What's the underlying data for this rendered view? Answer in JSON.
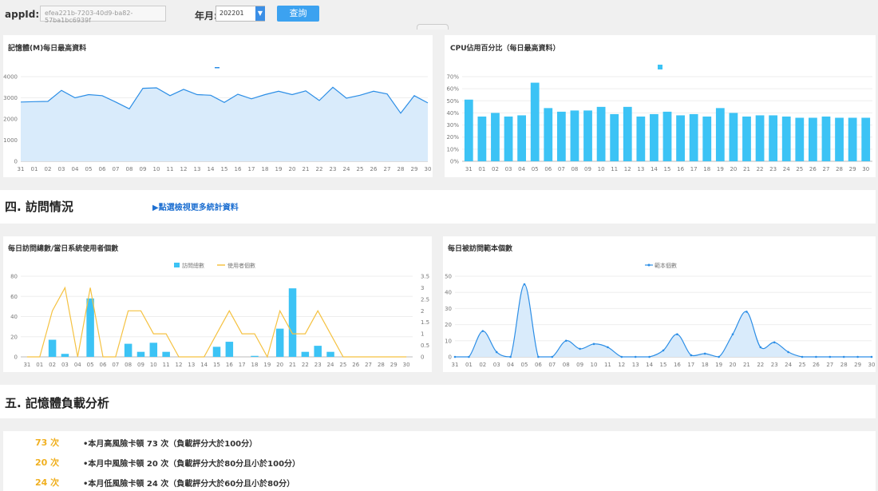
{
  "toolbar": {
    "appid_label": "appId:",
    "appid_value": "efea221b-7203-40d9-ba82-57ba1bc6939f",
    "month_label": "年月:",
    "month_value": "202201",
    "query_label": "查詢"
  },
  "days": [
    "31",
    "01",
    "02",
    "03",
    "04",
    "05",
    "06",
    "07",
    "08",
    "09",
    "10",
    "11",
    "12",
    "13",
    "14",
    "15",
    "16",
    "17",
    "18",
    "19",
    "20",
    "21",
    "22",
    "23",
    "24",
    "25",
    "26",
    "27",
    "28",
    "29",
    "30"
  ],
  "colors": {
    "accent": "#3ca2f0",
    "bar": "#3cc3f5",
    "line": "#f5c242",
    "area": "#d9ebfb",
    "stroke": "#2c8ee6"
  },
  "sections": {
    "visits_title": "四. 訪問情況",
    "visits_link": "▶點選檢視更多統計資料",
    "memory_title": "五. 記憶體負載分析"
  },
  "stats": [
    {
      "count": "73 次",
      "text": "•本月高風險卡頓 73 次（負載評分大於100分）"
    },
    {
      "count": "20 次",
      "text": "•本月中風險卡頓 20 次（負載評分大於80分且小於100分）"
    },
    {
      "count": "24 次",
      "text": "•本月低風險卡頓 24 次（負載評分大於60分且小於80分）"
    }
  ],
  "chart_data": [
    {
      "type": "area",
      "title": "記憶體(M)每日最高資料",
      "legend": "",
      "ylim": [
        0,
        4000
      ],
      "yticks": [
        "0",
        "1000",
        "2000",
        "3000",
        "4000"
      ],
      "values": [
        2800,
        2820,
        2830,
        3350,
        3000,
        3150,
        3100,
        2800,
        2480,
        3450,
        3470,
        3100,
        3400,
        3150,
        3120,
        2780,
        3170,
        2950,
        3150,
        3310,
        3150,
        3330,
        2870,
        3500,
        2980,
        3120,
        3310,
        3180,
        2270,
        3100,
        2760
      ]
    },
    {
      "type": "bar",
      "title": "CPU佔用百分比（每日最高資料）",
      "ylim": [
        0,
        70
      ],
      "yticks": [
        "0%",
        "10%",
        "20%",
        "30%",
        "40%",
        "50%",
        "60%",
        "70%"
      ],
      "values": [
        51,
        37,
        40,
        37,
        38,
        65,
        44,
        41,
        42,
        42,
        45,
        39,
        45,
        37,
        39,
        41,
        38,
        39,
        37,
        44,
        40,
        37,
        38,
        38,
        37,
        36,
        36,
        37,
        36,
        36,
        36
      ]
    },
    {
      "type": "bar+line",
      "title": "每日訪問總數/當日系統使用者個數",
      "series": [
        {
          "name": "訪問總數",
          "type": "bar",
          "values": [
            0,
            0,
            17,
            3,
            0,
            58,
            0,
            0,
            13,
            5,
            14,
            5,
            0,
            0,
            0,
            10,
            15,
            0,
            1,
            0,
            28,
            68,
            5,
            11,
            5,
            0,
            0,
            0,
            0,
            0,
            0
          ]
        },
        {
          "name": "使用者個數",
          "type": "line",
          "values": [
            0,
            0,
            2,
            3,
            0,
            3,
            0,
            0,
            2,
            2,
            1,
            1,
            0,
            0,
            0,
            1,
            2,
            1,
            1,
            0,
            2,
            1,
            1,
            2,
            1,
            0,
            0,
            0,
            0,
            0,
            0
          ]
        }
      ],
      "ylim_left": [
        0,
        80
      ],
      "ylim_right": [
        0,
        3.5
      ],
      "yticks_left": [
        "0",
        "20",
        "40",
        "60",
        "80"
      ],
      "yticks_right": [
        "0",
        "0.5",
        "1",
        "1.5",
        "2",
        "2.5",
        "3",
        "3.5"
      ]
    },
    {
      "type": "area",
      "title": "每日被訪問範本個數",
      "legend": "範本個數",
      "ylim": [
        0,
        50
      ],
      "yticks": [
        "0",
        "10",
        "20",
        "30",
        "40",
        "50"
      ],
      "values": [
        0,
        0,
        16,
        3,
        0,
        45,
        0,
        0,
        10,
        5,
        8,
        6,
        0,
        0,
        0,
        4,
        14,
        1,
        2,
        0,
        14,
        28,
        6,
        9,
        3,
        0,
        0,
        0,
        0,
        0,
        0
      ]
    }
  ]
}
